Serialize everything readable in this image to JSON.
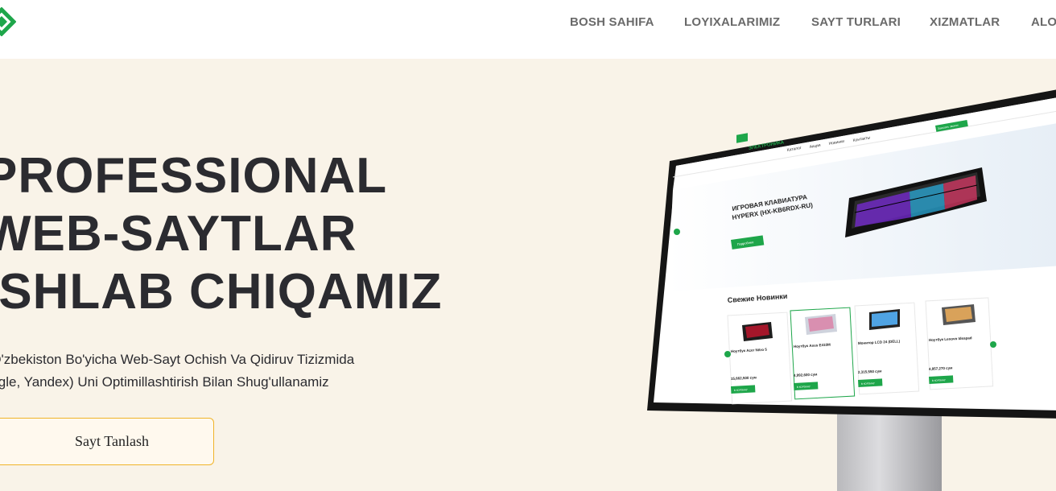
{
  "nav": {
    "items": [
      "BOSH SAHIFA",
      "LOYIXALARIMIZ",
      "SAYT TURLARI",
      "XIZMATLAR",
      "ALO"
    ]
  },
  "hero": {
    "headline_lines": [
      "PROFESSIONAL",
      "WEB-SAYTLAR",
      "ISHLAB CHIQAMIZ"
    ],
    "subtitle_lines": [
      "Biz O'zbekiston Bo'yicha Web-Sayt Ochish Va Qidiruv Tizizmida",
      "(Google, Yandex) Uni Optimillashtirish Bilan Shug'ullanamiz"
    ],
    "cta_label": "Sayt Tanlash"
  },
  "mock_site": {
    "logo_text": "ЭЛЕКТРОНИКА",
    "nav": [
      "Каталог",
      "Акции",
      "Новинки",
      "Контакты"
    ],
    "call_button": "Заказать звонок",
    "banner_title_1": "ИГРОВАЯ КЛАВИАТУРА",
    "banner_title_2": "HYPERX (HX-KB6RDX-RU)",
    "banner_button": "Подробнее",
    "section_title": "Свежие Новинки",
    "products": [
      {
        "name": "Ноутбук Acer Nitro 5",
        "price": "15,662,500 сум"
      },
      {
        "name": "Ноутбук Asus E410M",
        "price": "4,992,600 сум"
      },
      {
        "name": "Монитор LCD 24 (DELL)",
        "price": "2,315,550 сум"
      },
      {
        "name": "Ноутбук Lenovo Ideapad",
        "price": "4,857,270 сум"
      }
    ],
    "cart_label": "В КОРЗИНУ"
  },
  "colors": {
    "hero_bg": "#f9f3e8",
    "headline": "#2b2b30",
    "accent_green": "#1ea64a",
    "cta_border": "#f0b429"
  }
}
